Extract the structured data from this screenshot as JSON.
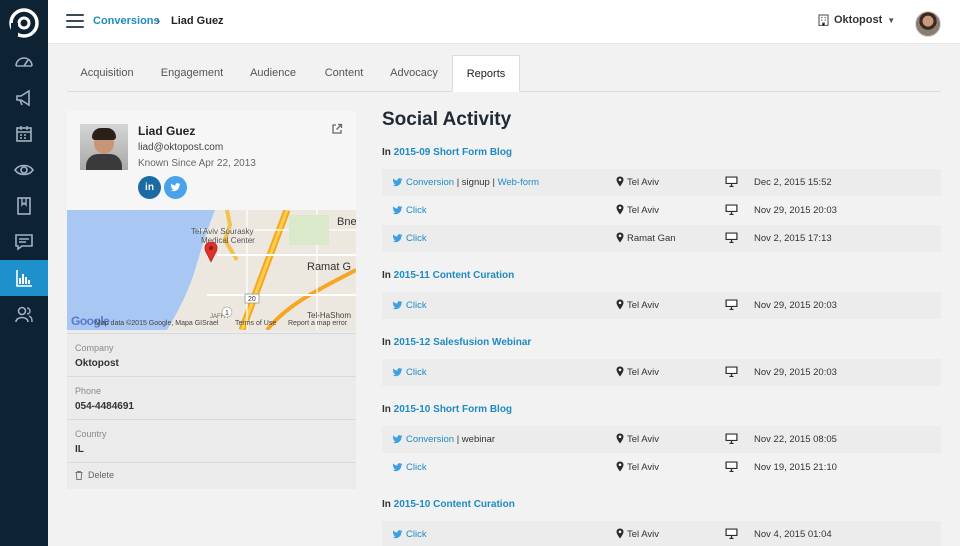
{
  "colors": {
    "sidebar": "#0d2233",
    "accent": "#1e90cc",
    "link": "#1e8bc3"
  },
  "sidebar": {
    "items": [
      {
        "icon": "dashboard-icon"
      },
      {
        "icon": "megaphone-icon"
      },
      {
        "icon": "calendar-icon"
      },
      {
        "icon": "eye-icon"
      },
      {
        "icon": "bookmark-icon"
      },
      {
        "icon": "chat-icon"
      },
      {
        "icon": "reports-icon",
        "active": true
      },
      {
        "icon": "users-icon"
      }
    ]
  },
  "header": {
    "breadcrumb_link": "Conversions",
    "breadcrumb_sep": "›",
    "breadcrumb_current": "Liad Guez",
    "org_name": "Oktopost"
  },
  "tabs": [
    "Acquisition",
    "Engagement",
    "Audience",
    "Content",
    "Advocacy",
    "Reports"
  ],
  "active_tab": "Reports",
  "profile": {
    "name": "Liad Guez",
    "email": "liad@oktopost.com",
    "since": "Known Since Apr 22, 2013",
    "linkedin_label": "in",
    "map": {
      "places": [
        "Bne",
        "Tel Aviv Sourasky",
        "Medical Center",
        "Ramat G",
        "Tel-HaShom",
        "JAFFA",
        "20",
        "1"
      ],
      "credit": "Map data ©2015 Google, Mapa GISrael",
      "terms": "Terms of Use",
      "report": "Report a map error",
      "google": "Google"
    },
    "fields": [
      {
        "label": "Company",
        "value": "Oktopost"
      },
      {
        "label": "Phone",
        "value": "054-4484691"
      },
      {
        "label": "Country",
        "value": "IL"
      }
    ],
    "delete_label": "Delete"
  },
  "activity": {
    "title": "Social Activity",
    "groups": [
      {
        "prefix": "In",
        "campaign": "2015-09 Short Form Blog",
        "rows": [
          {
            "parts": [
              {
                "t": "Conversion",
                "link": true
              },
              {
                "t": " | signup | ",
                "link": false
              },
              {
                "t": "Web-form",
                "link": true
              }
            ],
            "location": "Tel Aviv",
            "date": "Dec 2, 2015 15:52"
          },
          {
            "parts": [
              {
                "t": "Click",
                "link": true
              }
            ],
            "location": "Tel Aviv",
            "date": "Nov 29, 2015 20:03"
          },
          {
            "parts": [
              {
                "t": "Click",
                "link": true
              }
            ],
            "location": "Ramat Gan",
            "date": "Nov 2, 2015 17:13"
          }
        ]
      },
      {
        "prefix": "In",
        "campaign": "2015-11 Content Curation",
        "rows": [
          {
            "parts": [
              {
                "t": "Click",
                "link": true
              }
            ],
            "location": "Tel Aviv",
            "date": "Nov 29, 2015 20:03"
          }
        ]
      },
      {
        "prefix": "In",
        "campaign": "2015-12 Salesfusion Webinar",
        "rows": [
          {
            "parts": [
              {
                "t": "Click",
                "link": true
              }
            ],
            "location": "Tel Aviv",
            "date": "Nov 29, 2015 20:03"
          }
        ]
      },
      {
        "prefix": "In",
        "campaign": "2015-10 Short Form Blog",
        "rows": [
          {
            "parts": [
              {
                "t": "Conversion",
                "link": true
              },
              {
                "t": " | webinar",
                "link": false
              }
            ],
            "location": "Tel Aviv",
            "date": "Nov 22, 2015 08:05"
          },
          {
            "parts": [
              {
                "t": "Click",
                "link": true
              }
            ],
            "location": "Tel Aviv",
            "date": "Nov 19, 2015 21:10"
          }
        ]
      },
      {
        "prefix": "In",
        "campaign": "2015-10 Content Curation",
        "rows": [
          {
            "parts": [
              {
                "t": "Click",
                "link": true
              }
            ],
            "location": "Tel Aviv",
            "date": "Nov 4, 2015 01:04"
          }
        ]
      }
    ]
  }
}
